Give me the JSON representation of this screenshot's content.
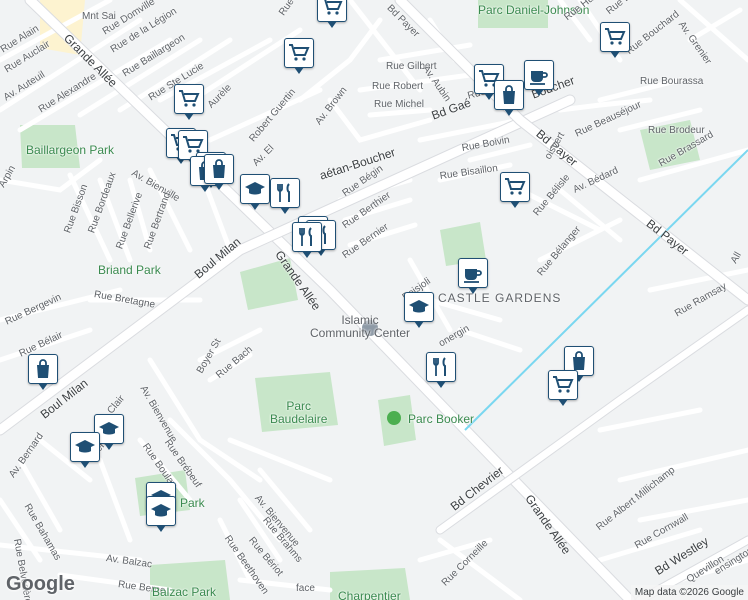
{
  "attribution": "Map data ©2026 Google",
  "logo": "Google",
  "colors": {
    "background": "#f1f3f4",
    "park": "#c8e6c9",
    "major_road": "#ffffff",
    "pin_border": "#1f4f74",
    "rail": "#7ad7f0"
  },
  "labels": [
    {
      "id": "mnt-sai",
      "text": "Mnt Sai",
      "kind": "street"
    },
    {
      "id": "rue-alain",
      "text": "Rue Alain",
      "kind": "street"
    },
    {
      "id": "rue-auclair",
      "text": "Rue Auclair",
      "kind": "street"
    },
    {
      "id": "av-auteuil",
      "text": "Av. Auteuil",
      "kind": "street"
    },
    {
      "id": "rue-domville",
      "text": "Rue Domville",
      "kind": "street"
    },
    {
      "id": "rue-de-la-legion",
      "text": "Rue de la Légion",
      "kind": "street"
    },
    {
      "id": "grande-allee-nw",
      "text": "Grande Allée",
      "kind": "major"
    },
    {
      "id": "rue-baillargeon",
      "text": "Rue Baillargeon",
      "kind": "street"
    },
    {
      "id": "rue-ste-lucie",
      "text": "Rue Ste Lucie",
      "kind": "street"
    },
    {
      "id": "rue-alexandre",
      "text": "Rue Alexandre",
      "kind": "street"
    },
    {
      "id": "rue-aurele",
      "text": "Aurèle",
      "kind": "street"
    },
    {
      "id": "rue-robert-guertin",
      "text": "Robert Guertin",
      "kind": "street"
    },
    {
      "id": "av-brown",
      "text": "Av. Brown",
      "kind": "street"
    },
    {
      "id": "rue-orchard",
      "text": "Rue Orcha",
      "kind": "street"
    },
    {
      "id": "rue-red",
      "text": "Rue Red",
      "kind": "street"
    },
    {
      "id": "bd-payer-n",
      "text": "Bd Payer",
      "kind": "street"
    },
    {
      "id": "parc-daniel-johnson",
      "text": "Parc Daniel-Johnson",
      "kind": "park"
    },
    {
      "id": "rue-gilbert",
      "text": "Rue Gilbert",
      "kind": "street"
    },
    {
      "id": "av-aubin",
      "text": "Av. Aubin",
      "kind": "street"
    },
    {
      "id": "rue-robert",
      "text": "Rue Robert",
      "kind": "street"
    },
    {
      "id": "rue-michel",
      "text": "Rue Michel",
      "kind": "street"
    },
    {
      "id": "rue-maur",
      "text": "Rue Mauri",
      "kind": "street"
    },
    {
      "id": "bd-gaetan-n",
      "text": "Bd Gaé",
      "kind": "major"
    },
    {
      "id": "boucher-n",
      "text": "Boucher",
      "kind": "major"
    },
    {
      "id": "rue-hu",
      "text": "Rue Hu",
      "kind": "street"
    },
    {
      "id": "rue-bar",
      "text": "Rue Bar",
      "kind": "street"
    },
    {
      "id": "av-grenier",
      "text": "Av. Grenier",
      "kind": "street"
    },
    {
      "id": "rue-bouchard",
      "text": "Rue Bouchard",
      "kind": "street"
    },
    {
      "id": "rue-bourassa",
      "text": "Rue Bourassa",
      "kind": "street"
    },
    {
      "id": "rue-beausejour",
      "text": "Rue Beauséjour",
      "kind": "street"
    },
    {
      "id": "rue-brodeur",
      "text": "Rue Brodeur",
      "kind": "street"
    },
    {
      "id": "rue-brassard",
      "text": "Rue Brassard",
      "kind": "street"
    },
    {
      "id": "bd-payer-mid",
      "text": "Bd Payer",
      "kind": "major"
    },
    {
      "id": "baillargeon-park",
      "text": "Baillargeon Park",
      "kind": "park"
    },
    {
      "id": "av-bienville",
      "text": "Av. Bienville",
      "kind": "street"
    },
    {
      "id": "rue-arpin",
      "text": "Arpin",
      "kind": "street"
    },
    {
      "id": "rue-bisson",
      "text": "Rue Bisson",
      "kind": "street"
    },
    {
      "id": "rue-bordeaux",
      "text": "Rue Bordeaux",
      "kind": "street"
    },
    {
      "id": "rue-bellerive",
      "text": "Rue Bellerive",
      "kind": "street"
    },
    {
      "id": "rue-bertrand",
      "text": "Rue Bertrand",
      "kind": "street"
    },
    {
      "id": "av-elm",
      "text": "Av. El",
      "kind": "street"
    },
    {
      "id": "bd-gaetan-s",
      "text": "aétan-Boucher",
      "kind": "major"
    },
    {
      "id": "rue-boivin",
      "text": "Rue Boivin",
      "kind": "street"
    },
    {
      "id": "rue-bisaillon",
      "text": "Rue Bisaillon",
      "kind": "street"
    },
    {
      "id": "rue-boisvert",
      "text": "oisvert",
      "kind": "street"
    },
    {
      "id": "rue-begin",
      "text": "Rue Bégin",
      "kind": "street"
    },
    {
      "id": "rue-berthier",
      "text": "Rue Berthier",
      "kind": "street"
    },
    {
      "id": "rue-bernier",
      "text": "Rue Bernier",
      "kind": "street"
    },
    {
      "id": "rue-belisle",
      "text": "Rue Bélisle",
      "kind": "street"
    },
    {
      "id": "av-bedard",
      "text": "Av. Bédard",
      "kind": "street"
    },
    {
      "id": "bd-payer-s",
      "text": "Bd Payer",
      "kind": "major"
    },
    {
      "id": "rue-belanger",
      "text": "Rue Bélanger",
      "kind": "street"
    },
    {
      "id": "all",
      "text": "All",
      "kind": "street"
    },
    {
      "id": "briand-park",
      "text": "Briand Park",
      "kind": "park"
    },
    {
      "id": "boul-milan-n",
      "text": "Boul Milan",
      "kind": "major"
    },
    {
      "id": "grande-allee-mid",
      "text": "Grande Allée",
      "kind": "major"
    },
    {
      "id": "rue-bretagne",
      "text": "Rue Bretagne",
      "kind": "street"
    },
    {
      "id": "rue-bergevin",
      "text": "Rue Bergevin",
      "kind": "street"
    },
    {
      "id": "rue-belair",
      "text": "Rue Bélair",
      "kind": "street"
    },
    {
      "id": "islamic-community-center",
      "text": "Islamic\nCommunity Center",
      "kind": "poi"
    },
    {
      "id": "rue-boisjoli",
      "text": "Boisjoli",
      "kind": "street"
    },
    {
      "id": "castle-gardens",
      "text": "CASTLE GARDENS",
      "kind": "area"
    },
    {
      "id": "rue-ramsay",
      "text": "Rue Ramsay",
      "kind": "street"
    },
    {
      "id": "rue-bonergin",
      "text": "onergin",
      "kind": "street"
    },
    {
      "id": "boyer-st",
      "text": "Boyer St",
      "kind": "street"
    },
    {
      "id": "rue-bach",
      "text": "Rue Bach",
      "kind": "street"
    },
    {
      "id": "boul-milan-s",
      "text": "Boul Milan",
      "kind": "major"
    },
    {
      "id": "av-bienvenue-n",
      "text": "Av. Bienvenue",
      "kind": "street"
    },
    {
      "id": "parc-baudelaire",
      "text": "Parc\nBaudelaire",
      "kind": "park"
    },
    {
      "id": "parc-booker",
      "text": "Parc Booker",
      "kind": "park"
    },
    {
      "id": "rue-brebeuf",
      "text": "Rue Brébeuf",
      "kind": "street"
    },
    {
      "id": "rue-boulay",
      "text": "Rue Boulay",
      "kind": "street"
    },
    {
      "id": "rue-clair",
      "text": "Clair",
      "kind": "street"
    },
    {
      "id": "rue-rard",
      "text": "érard",
      "kind": "street"
    },
    {
      "id": "av-bernard",
      "text": "Av. Bernard",
      "kind": "street"
    },
    {
      "id": "rue-bahamas",
      "text": "Rue Bahamas",
      "kind": "street"
    },
    {
      "id": "rue-belvedere",
      "text": "Rue Belvédère",
      "kind": "street"
    },
    {
      "id": "av-bienvenue-s",
      "text": "Av. Bienvenue",
      "kind": "street"
    },
    {
      "id": "rue-brahms",
      "text": "Rue Brahms",
      "kind": "street"
    },
    {
      "id": "rue-beriot",
      "text": "Rue Bériot",
      "kind": "street"
    },
    {
      "id": "rue-beethoven",
      "text": "Rue Beethoven",
      "kind": "street"
    },
    {
      "id": "v-park",
      "text": "V",
      "kind": "park"
    },
    {
      "id": "park-suffix",
      "text": "Park",
      "kind": "park"
    },
    {
      "id": "bd-chevrier",
      "text": "Bd Chevrier",
      "kind": "major"
    },
    {
      "id": "grande-allee-se",
      "text": "Grande Allée",
      "kind": "major"
    },
    {
      "id": "rue-albert-millichamp",
      "text": "Rue Albert Millichamp",
      "kind": "street"
    },
    {
      "id": "rue-cornwall",
      "text": "Rue Cornwall",
      "kind": "street"
    },
    {
      "id": "bd-westley",
      "text": "Bd Westley",
      "kind": "major"
    },
    {
      "id": "rue-quevillon",
      "text": "Quevillon",
      "kind": "street"
    },
    {
      "id": "rue-kensington",
      "text": "ensington",
      "kind": "street"
    },
    {
      "id": "rue-corneille",
      "text": "Rue Corneille",
      "kind": "street"
    },
    {
      "id": "rue-face",
      "text": "face",
      "kind": "street"
    },
    {
      "id": "av-balzac",
      "text": "Av. Balzac",
      "kind": "street"
    },
    {
      "id": "rue-berne",
      "text": "Rue Berne",
      "kind": "street"
    },
    {
      "id": "balzac-park",
      "text": "Balzac Park",
      "kind": "park"
    },
    {
      "id": "charpentier",
      "text": "Charpentier",
      "kind": "park"
    }
  ],
  "markers": [
    {
      "id": "m1",
      "icon": "shopping-cart"
    },
    {
      "id": "m2",
      "icon": "shopping-cart"
    },
    {
      "id": "m3",
      "icon": "shopping-cart"
    },
    {
      "id": "m4",
      "icon": "shopping-cart"
    },
    {
      "id": "m5",
      "icon": "coffee-cup"
    },
    {
      "id": "m6",
      "icon": "shopping-bag"
    },
    {
      "id": "m7",
      "icon": "shopping-cart"
    },
    {
      "id": "m8",
      "icon": "shopping-cart"
    },
    {
      "id": "m9",
      "icon": "shopping-cart"
    },
    {
      "id": "m10",
      "icon": "shopping-cart"
    },
    {
      "id": "m11",
      "icon": "shopping-bag"
    },
    {
      "id": "m12",
      "icon": "shopping-bag"
    },
    {
      "id": "m13",
      "icon": "graduation-cap"
    },
    {
      "id": "m14",
      "icon": "fork-knife"
    },
    {
      "id": "m15",
      "icon": "shopping-cart"
    },
    {
      "id": "m16",
      "icon": "fork-knife"
    },
    {
      "id": "m17",
      "icon": "fork-knife"
    },
    {
      "id": "m18",
      "icon": "fork-knife"
    },
    {
      "id": "m19",
      "icon": "coffee-cup"
    },
    {
      "id": "m20",
      "icon": "graduation-cap"
    },
    {
      "id": "m21",
      "icon": "fork-knife"
    },
    {
      "id": "m22",
      "icon": "shopping-bag"
    },
    {
      "id": "m23",
      "icon": "shopping-bag"
    },
    {
      "id": "m24",
      "icon": "shopping-cart"
    },
    {
      "id": "m25",
      "icon": "graduation-cap"
    },
    {
      "id": "m26",
      "icon": "graduation-cap"
    },
    {
      "id": "m27",
      "icon": "graduation-cap"
    },
    {
      "id": "m28",
      "icon": "graduation-cap"
    }
  ]
}
